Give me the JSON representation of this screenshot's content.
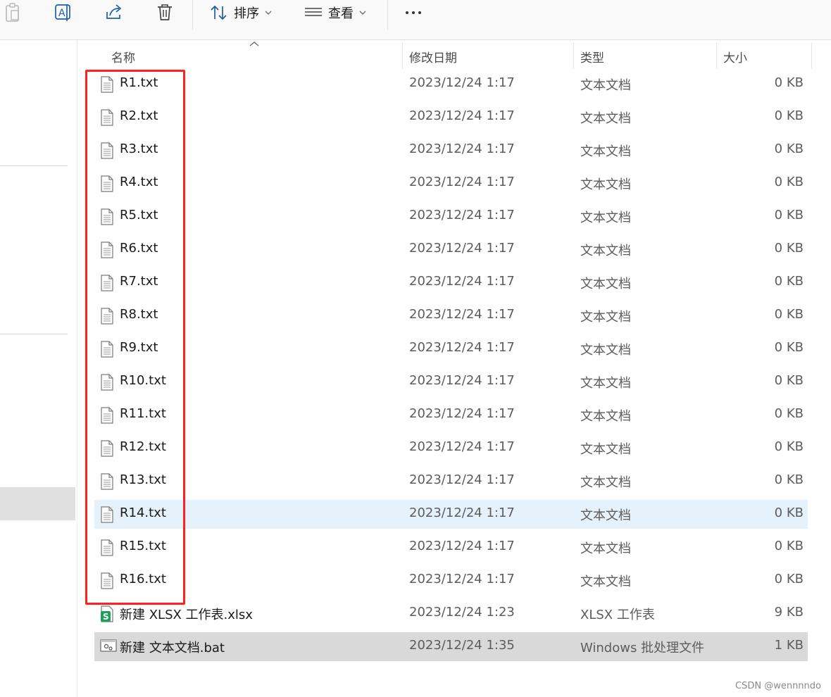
{
  "toolbar": {
    "sort_label": "排序",
    "view_label": "查看"
  },
  "columns": {
    "name": "名称",
    "date": "修改日期",
    "type": "类型",
    "size": "大小"
  },
  "files": [
    {
      "name": "R1.txt",
      "date": "2023/12/24 1:17",
      "type": "文本文档",
      "size": "0 KB",
      "icon": "text-file-icon"
    },
    {
      "name": "R2.txt",
      "date": "2023/12/24 1:17",
      "type": "文本文档",
      "size": "0 KB",
      "icon": "text-file-icon"
    },
    {
      "name": "R3.txt",
      "date": "2023/12/24 1:17",
      "type": "文本文档",
      "size": "0 KB",
      "icon": "text-file-icon"
    },
    {
      "name": "R4.txt",
      "date": "2023/12/24 1:17",
      "type": "文本文档",
      "size": "0 KB",
      "icon": "text-file-icon"
    },
    {
      "name": "R5.txt",
      "date": "2023/12/24 1:17",
      "type": "文本文档",
      "size": "0 KB",
      "icon": "text-file-icon"
    },
    {
      "name": "R6.txt",
      "date": "2023/12/24 1:17",
      "type": "文本文档",
      "size": "0 KB",
      "icon": "text-file-icon"
    },
    {
      "name": "R7.txt",
      "date": "2023/12/24 1:17",
      "type": "文本文档",
      "size": "0 KB",
      "icon": "text-file-icon"
    },
    {
      "name": "R8.txt",
      "date": "2023/12/24 1:17",
      "type": "文本文档",
      "size": "0 KB",
      "icon": "text-file-icon"
    },
    {
      "name": "R9.txt",
      "date": "2023/12/24 1:17",
      "type": "文本文档",
      "size": "0 KB",
      "icon": "text-file-icon"
    },
    {
      "name": "R10.txt",
      "date": "2023/12/24 1:17",
      "type": "文本文档",
      "size": "0 KB",
      "icon": "text-file-icon"
    },
    {
      "name": "R11.txt",
      "date": "2023/12/24 1:17",
      "type": "文本文档",
      "size": "0 KB",
      "icon": "text-file-icon"
    },
    {
      "name": "R12.txt",
      "date": "2023/12/24 1:17",
      "type": "文本文档",
      "size": "0 KB",
      "icon": "text-file-icon"
    },
    {
      "name": "R13.txt",
      "date": "2023/12/24 1:17",
      "type": "文本文档",
      "size": "0 KB",
      "icon": "text-file-icon"
    },
    {
      "name": "R14.txt",
      "date": "2023/12/24 1:17",
      "type": "文本文档",
      "size": "0 KB",
      "icon": "text-file-icon",
      "state": "hover"
    },
    {
      "name": "R15.txt",
      "date": "2023/12/24 1:17",
      "type": "文本文档",
      "size": "0 KB",
      "icon": "text-file-icon"
    },
    {
      "name": "R16.txt",
      "date": "2023/12/24 1:17",
      "type": "文本文档",
      "size": "0 KB",
      "icon": "text-file-icon"
    },
    {
      "name": "新建 XLSX 工作表.xlsx",
      "date": "2023/12/24 1:23",
      "type": "XLSX 工作表",
      "size": "9 KB",
      "icon": "spreadsheet-icon"
    },
    {
      "name": "新建 文本文档.bat",
      "date": "2023/12/24 1:35",
      "type": "Windows 批处理文件",
      "size": "1 KB",
      "icon": "batch-file-icon",
      "state": "selected"
    }
  ],
  "colors": {
    "annotation_red": "#ff2020",
    "hover_row": "#e5f1fb",
    "selected_row": "#d9d9d9",
    "spreadsheet_green": "#1e9e5a"
  },
  "watermark": "CSDN @wennnndo"
}
